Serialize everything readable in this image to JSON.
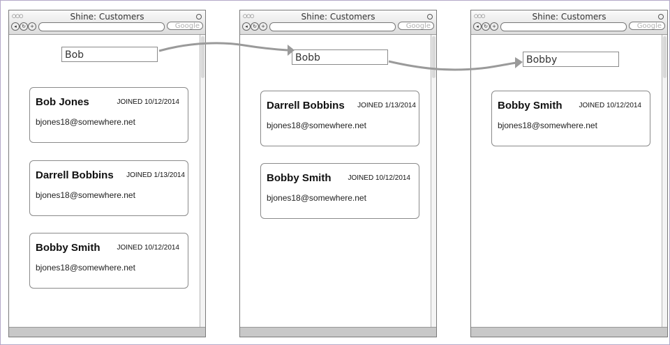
{
  "colors": {
    "arrow": "#9a9a9a",
    "frame": "#b3a8c8"
  },
  "screens": [
    {
      "title": "Shine: Customers",
      "search_button": "Google",
      "query": "Bob",
      "results": [
        {
          "name": "Bob Jones",
          "joined": "JOINED 10/12/2014",
          "email": "bjones18@somewhere.net"
        },
        {
          "name": "Darrell Bobbins",
          "joined": "JOINED 1/13/2014",
          "email": "bjones18@somewhere.net"
        },
        {
          "name": "Bobby Smith",
          "joined": "JOINED 10/12/2014",
          "email": "bjones18@somewhere.net"
        }
      ]
    },
    {
      "title": "Shine: Customers",
      "search_button": "Google",
      "query": "Bobb",
      "results": [
        {
          "name": "Darrell Bobbins",
          "joined": "JOINED 1/13/2014",
          "email": "bjones18@somewhere.net"
        },
        {
          "name": "Bobby Smith",
          "joined": "JOINED 10/12/2014",
          "email": "bjones18@somewhere.net"
        }
      ]
    },
    {
      "title": "Shine: Customers",
      "search_button": "Google",
      "query": "Bobby",
      "results": [
        {
          "name": "Bobby Smith",
          "joined": "JOINED 10/12/2014",
          "email": "bjones18@somewhere.net"
        }
      ]
    }
  ]
}
